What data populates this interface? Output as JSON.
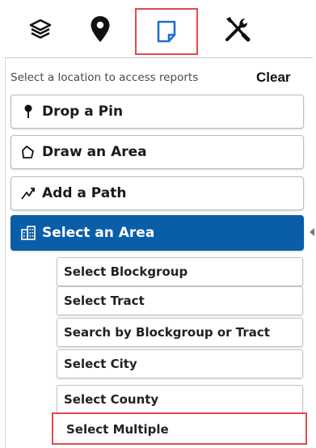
{
  "toolbar": {
    "tools": [
      {
        "icon": "layers-icon"
      },
      {
        "icon": "map-pin-icon"
      },
      {
        "icon": "report-page-icon",
        "selected": true
      },
      {
        "icon": "tools-icon"
      }
    ],
    "highlight_color": "#e24a4a"
  },
  "panel": {
    "hint": "Select a location to access reports",
    "clear_label": "Clear"
  },
  "actions": {
    "drop_pin": "Drop a Pin",
    "draw_area": "Draw an Area",
    "add_path": "Add a Path",
    "select_area": "Select an Area"
  },
  "select_area_options": {
    "blockgroup": "Select Blockgroup",
    "tract": "Select Tract",
    "search": "Search by Blockgroup or Tract",
    "city": "Select City",
    "county": "Select County",
    "multiple": "Select Multiple"
  },
  "colors": {
    "active_button": "#0a5ea8"
  }
}
